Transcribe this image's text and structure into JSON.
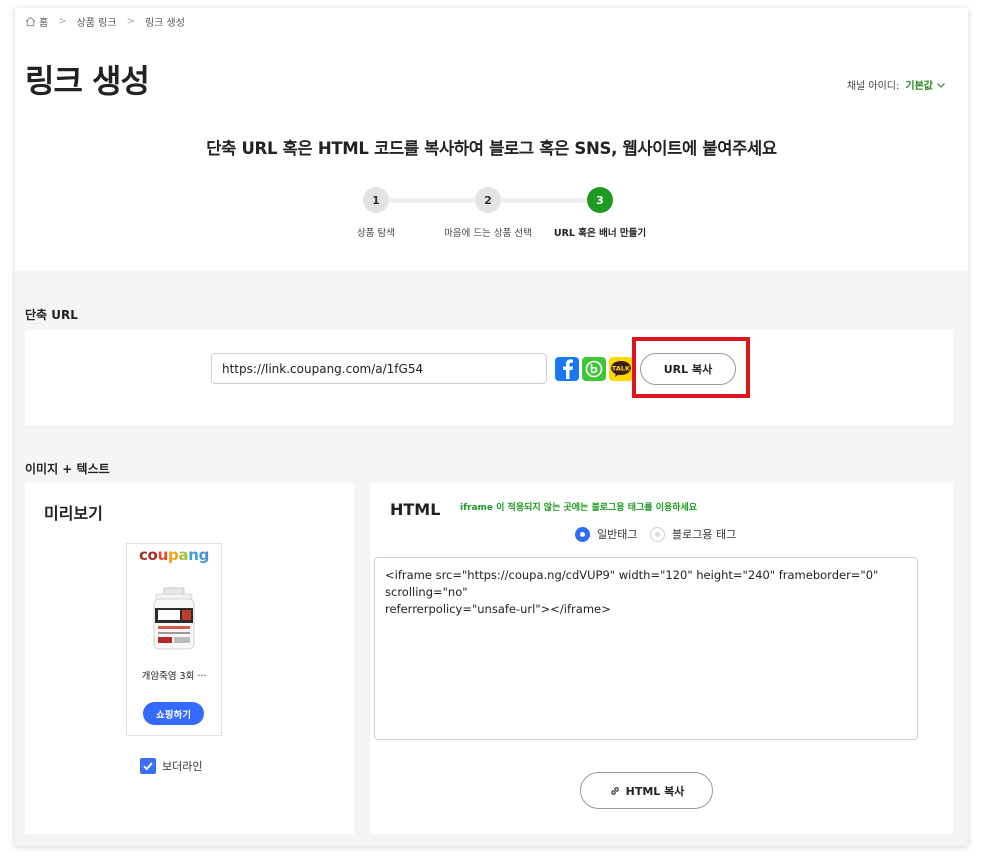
{
  "breadcrumb": {
    "items": [
      "홈",
      "상품 링크",
      "링크 생성"
    ]
  },
  "page_title": "링크 생성",
  "channel": {
    "label": "채널 아이디:",
    "value": "기본값"
  },
  "guide_text": "단축 URL 혹은 HTML 코드를 복사하여 블로그 혹은 SNS, 웹사이트에 붙여주세요",
  "steps": [
    {
      "number": "1",
      "label": "상품 탐색"
    },
    {
      "number": "2",
      "label": "마음에 드는 상품 선택"
    },
    {
      "number": "3",
      "label": "URL 혹은 배너 만들기"
    }
  ],
  "short_url": {
    "section_title": "단축 URL",
    "url": "https://link.coupang.com/a/1fG54",
    "kakao_label": "TALK",
    "copy_label": "URL 복사"
  },
  "image_text": {
    "section_title": "이미지 + 텍스트",
    "preview_title": "미리보기",
    "logo": [
      "c",
      "o",
      "u",
      "p",
      "a",
      "n",
      "g"
    ],
    "product_name": "개암죽염 3회 ···",
    "shop_label": "쇼핑하기",
    "borderline_label": "보더라인",
    "html_title": "HTML",
    "html_note": "iframe 이 적용되지 않는 곳에는 블로그용 태그를 이용하세요",
    "radio_normal": "일반태그",
    "radio_blog": "블로그용 태그",
    "code": "<iframe src=\"https://coupa.ng/cdVUP9\" width=\"120\" height=\"240\" frameborder=\"0\" scrolling=\"no\"\nreferrerpolicy=\"unsafe-url\"></iframe>",
    "copy_label": "HTML 복사"
  },
  "colors": {
    "accent_green": "#1f9a22",
    "highlight_red": "#e0141e",
    "shop_blue": "#346aff",
    "logo_colors": [
      "#a2312b",
      "#a2312b",
      "#e5482e",
      "#f2a11c",
      "#a6c13b",
      "#3b9fd8",
      "#4c8fd6"
    ]
  }
}
